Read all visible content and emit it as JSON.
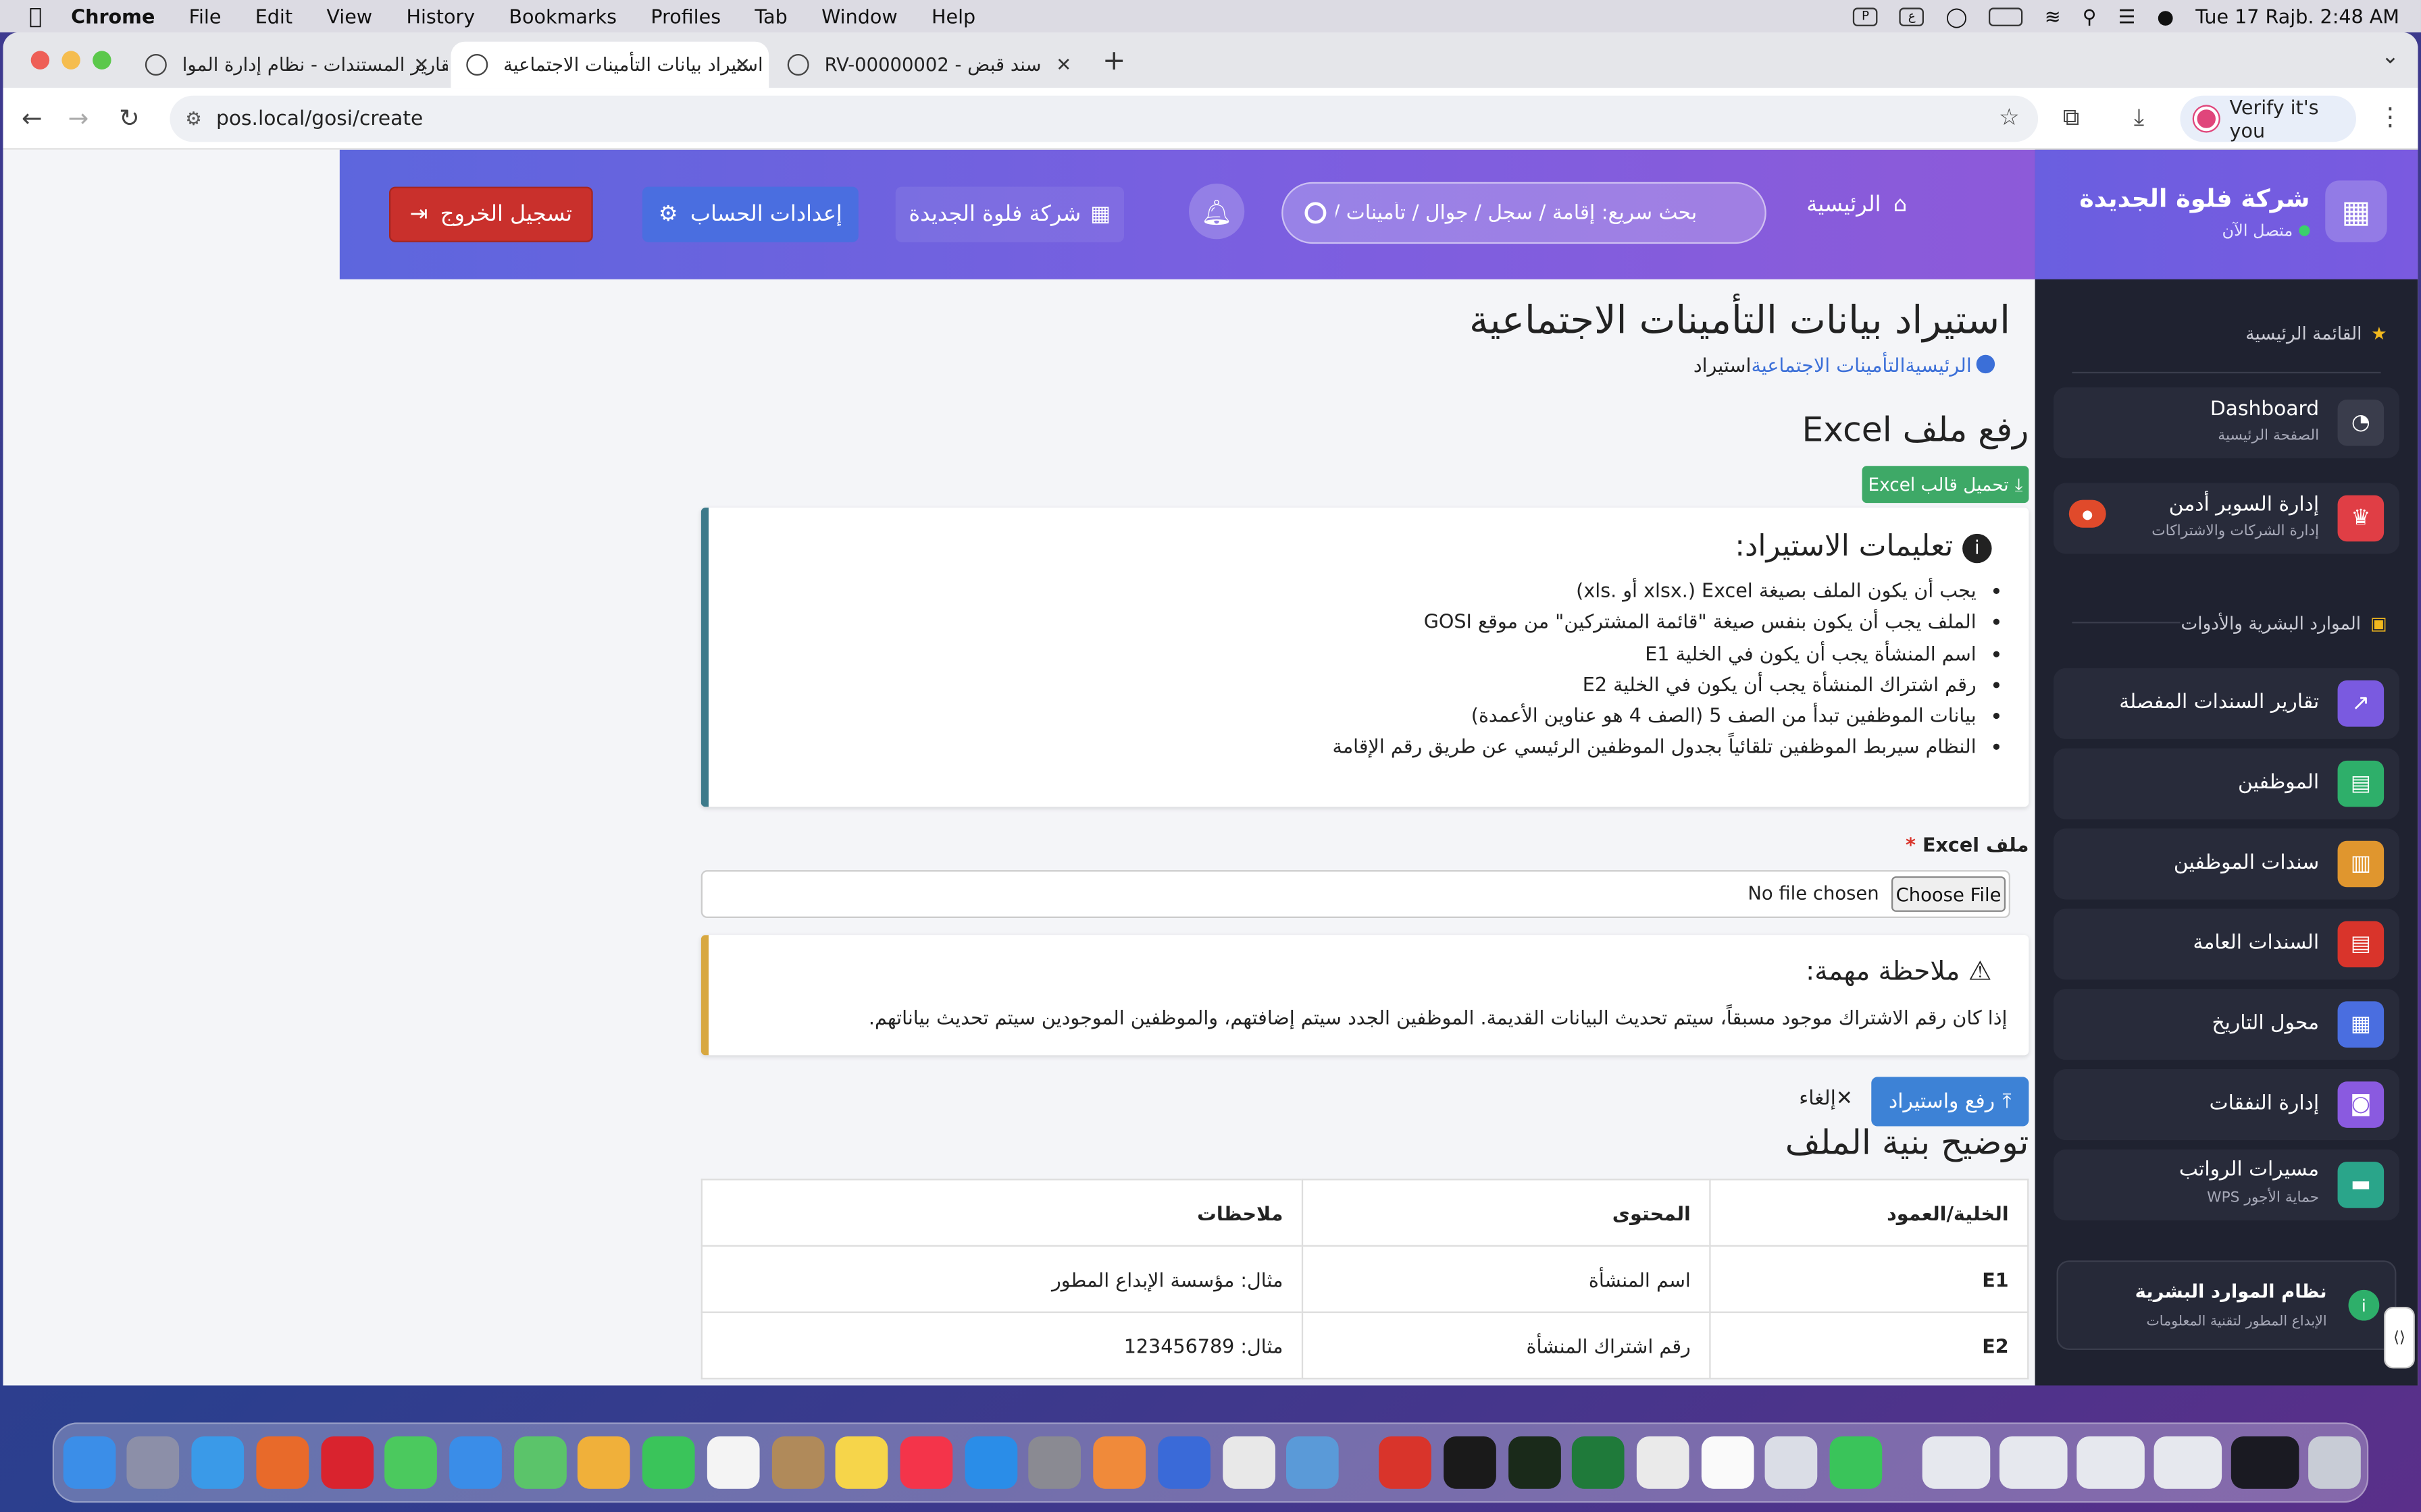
{
  "menubar": {
    "apple": "",
    "app": "Chrome",
    "items": [
      "File",
      "Edit",
      "View",
      "History",
      "Bookmarks",
      "Profiles",
      "Tab",
      "Window",
      "Help"
    ],
    "datetime": "Tue 17 Rajb.  2:48 AM"
  },
  "tabs": [
    {
      "title": "تقارير المستندات - نظام إدارة الموا"
    },
    {
      "title": "استيراد بيانات التأمينات الاجتماعية"
    },
    {
      "title": "RV-00000002 - سند قبض"
    }
  ],
  "address": {
    "url": "pos.local/gosi/create"
  },
  "verify": {
    "label": "Verify it's you"
  },
  "header": {
    "logout": "تسجيل الخروج",
    "account": "إعدادات الحساب",
    "company": "شركة فلوة الجديدة",
    "search_placeholder": "بحث سريع: إقامة / سجل / جوال / تأمينات / مكتب",
    "home": "الرئيسية"
  },
  "sidebar": {
    "brand_title": "شركة فلوة الجديدة",
    "brand_status": "متصل الآن",
    "section_main": "القائمة الرئيسية",
    "section_hr": "الموارد البشرية والأدوات",
    "items": [
      {
        "label": "Dashboard",
        "sub": "الصفحة الرئيسية"
      },
      {
        "label": "إدارة السوبر أدمن",
        "sub": "إدارة الشركات والاشتراكات"
      },
      {
        "label": "تقارير السندات المفصلة",
        "sub": ""
      },
      {
        "label": "الموظفين",
        "sub": ""
      },
      {
        "label": "سندات الموظفين",
        "sub": ""
      },
      {
        "label": "السندات العامة",
        "sub": ""
      },
      {
        "label": "محول التاريخ",
        "sub": ""
      },
      {
        "label": "إدارة النفقات",
        "sub": ""
      },
      {
        "label": "مسيرات الرواتب",
        "sub": "حماية الأجور WPS"
      }
    ],
    "footer_title": "نظام الموارد البشرية",
    "footer_sub": "الإبداع المطور لتقنية المعلومات"
  },
  "content": {
    "title": "استيراد بيانات التأمينات الاجتماعية",
    "breadcrumb": {
      "home": "الرئيسية",
      "section": "التأمينات الاجتماعية",
      "current": "استيراد"
    },
    "upload_heading": "رفع ملف Excel",
    "download_template": "تحميل قالب Excel",
    "instructions_title": "تعليمات الاستيراد:",
    "instructions": [
      "يجب أن يكون الملف بصيغة Excel (.xlsx أو .xls)",
      "الملف يجب أن يكون بنفس صيغة \"قائمة المشتركين\" من موقع GOSI",
      "اسم المنشأة يجب أن يكون في الخلية E1",
      "رقم اشتراك المنشأة يجب أن يكون في الخلية E2",
      "بيانات الموظفين تبدأ من الصف 5 (الصف 4 هو عناوين الأعمدة)",
      "النظام سيربط الموظفين تلقائياً بجدول الموظفين الرئيسي عن طريق رقم الإقامة"
    ],
    "file_label": "ملف Excel",
    "file_required": "*",
    "choose_file": "Choose File",
    "no_file": "No file chosen",
    "note_title": "ملاحظة مهمة:",
    "note_body": "إذا كان رقم الاشتراك موجود مسبقاً، سيتم تحديث البيانات القديمة. الموظفين الجدد سيتم إضافتهم، والموظفين الموجودين سيتم تحديث بياناتهم.",
    "upload_button": "رفع واستيراد",
    "cancel": "إلغاء",
    "structure_heading": "توضيح بنية الملف",
    "table": {
      "headers": [
        "الخلية/العمود",
        "المحتوى",
        "ملاحظات"
      ],
      "rows": [
        [
          "E1",
          "اسم المنشأة",
          "مثال: مؤسسة الإبداع المطور"
        ],
        [
          "E2",
          "رقم اشتراك المنشأة",
          "مثال: 123456789"
        ]
      ]
    }
  },
  "colors": {
    "header_start": "#5d66dd",
    "header_end": "#8d5ad9",
    "sidebar_bg": "#1f2230",
    "logout": "#c9302c",
    "account": "#4a6ee0",
    "download": "#3ea967",
    "upload": "#3d82d6",
    "info_border": "#3d7a8a",
    "warn_border": "#d8a840"
  }
}
